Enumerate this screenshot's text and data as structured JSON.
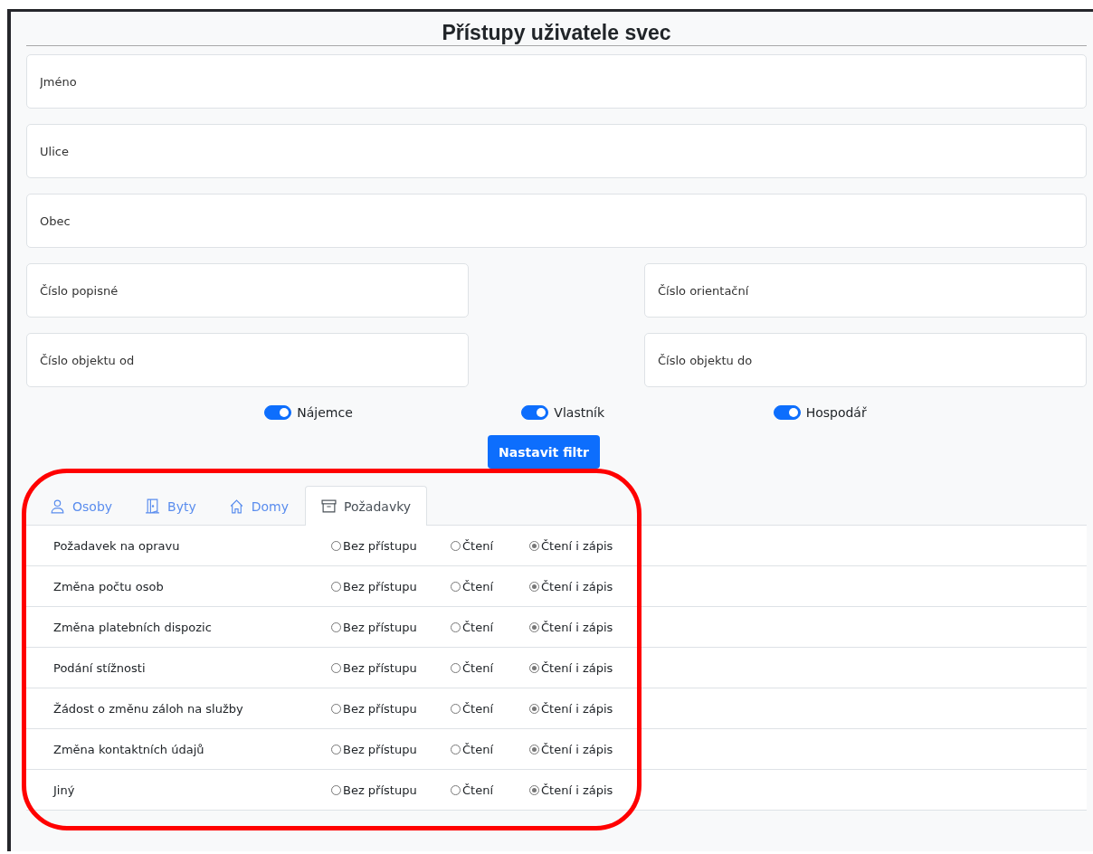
{
  "title": "Přístupy uživatele svec",
  "fields": [
    {
      "placeholder": "Jméno"
    },
    {
      "placeholder": "Ulice"
    },
    {
      "placeholder": "Obec"
    },
    {
      "placeholder": "Číslo popisné"
    },
    {
      "placeholder": "Číslo orientační"
    },
    {
      "placeholder": "Číslo objektu od"
    },
    {
      "placeholder": "Číslo objektu do"
    }
  ],
  "toggles": [
    {
      "label": "Nájemce",
      "on": true
    },
    {
      "label": "Vlastník",
      "on": true
    },
    {
      "label": "Hospodář",
      "on": true
    }
  ],
  "filter_button": "Nastavit filtr",
  "tabs": [
    {
      "label": "Osoby",
      "selected": false
    },
    {
      "label": "Byty",
      "selected": false
    },
    {
      "label": "Domy",
      "selected": false
    },
    {
      "label": "Požadavky",
      "selected": true
    }
  ],
  "rows": [
    {
      "name": "Požadavek na opravu",
      "options": [
        {
          "label": "Bez přístupu",
          "selected": false
        },
        {
          "label": "Čtení",
          "selected": false
        },
        {
          "label": "Čtení i zápis",
          "selected": true
        }
      ]
    },
    {
      "name": "Změna počtu osob",
      "options": [
        {
          "label": "Bez přístupu",
          "selected": false
        },
        {
          "label": "Čtení",
          "selected": false
        },
        {
          "label": "Čtení i zápis",
          "selected": true
        }
      ]
    },
    {
      "name": "Změna platebních dispozic",
      "options": [
        {
          "label": "Bez přístupu",
          "selected": false
        },
        {
          "label": "Čtení",
          "selected": false
        },
        {
          "label": "Čtení i zápis",
          "selected": true
        }
      ]
    },
    {
      "name": "Podání stížnosti",
      "options": [
        {
          "label": "Bez přístupu",
          "selected": false
        },
        {
          "label": "Čtení",
          "selected": false
        },
        {
          "label": "Čtení i zápis",
          "selected": true
        }
      ]
    },
    {
      "name": "Žádost o změnu záloh na služby",
      "options": [
        {
          "label": "Bez přístupu",
          "selected": false
        },
        {
          "label": "Čtení",
          "selected": false
        },
        {
          "label": "Čtení i zápis",
          "selected": true
        }
      ]
    },
    {
      "name": "Změna kontaktních údajů",
      "options": [
        {
          "label": "Bez přístupu",
          "selected": false
        },
        {
          "label": "Čtení",
          "selected": false
        },
        {
          "label": "Čtení i zápis",
          "selected": true
        }
      ]
    },
    {
      "name": "Jiný",
      "options": [
        {
          "label": "Bez přístupu",
          "selected": false
        },
        {
          "label": "Čtení",
          "selected": false
        },
        {
          "label": "Čtení i zápis",
          "selected": true
        }
      ]
    }
  ],
  "highlight": {
    "color": "#ff0000"
  }
}
